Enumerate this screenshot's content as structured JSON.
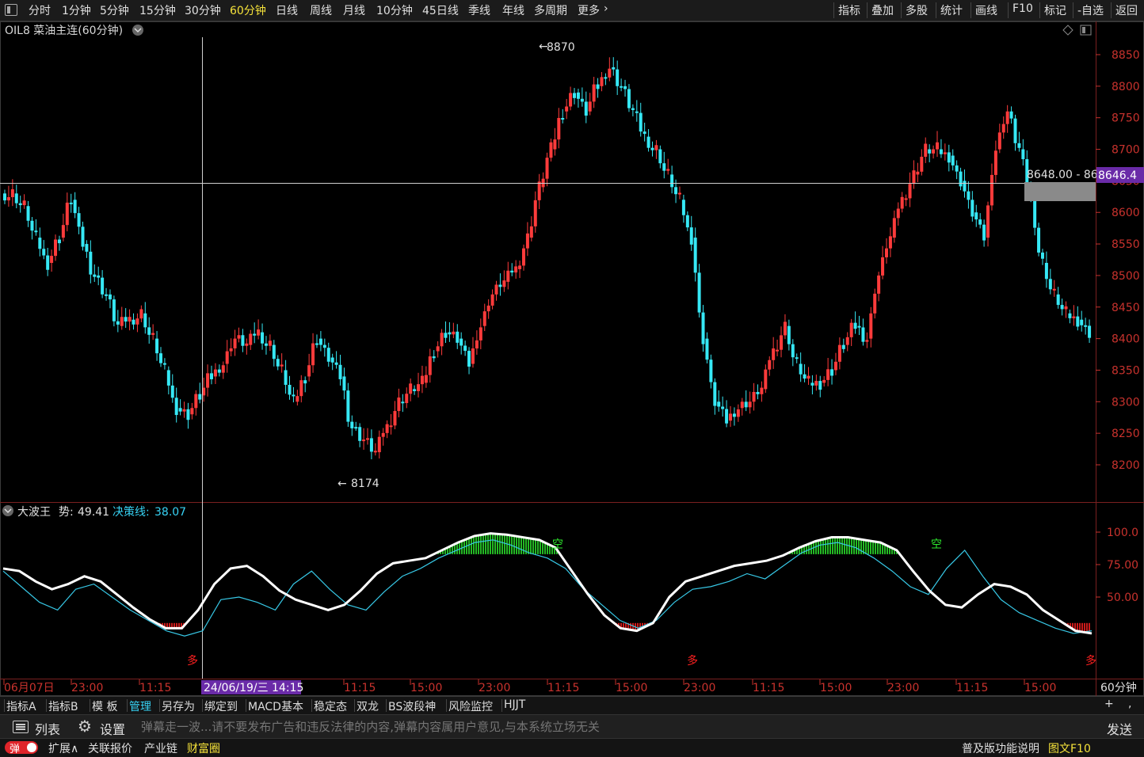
{
  "toolbar": {
    "timeframes": [
      "分时",
      "1分钟",
      "5分钟",
      "15分钟",
      "30分钟",
      "60分钟",
      "日线",
      "周线",
      "月线",
      "10分钟",
      "45日线",
      "季线",
      "年线",
      "多周期",
      "更多"
    ],
    "active_timeframe": "60分钟",
    "right_items": [
      "指标",
      "叠加",
      "多股",
      "统计",
      "画线",
      "F10",
      "标记",
      "-自选",
      "返回"
    ]
  },
  "main_chart": {
    "title": "OIL8 菜油主连(60分钟)",
    "high_label": "8870",
    "low_label": "8174",
    "crosshair_price": "8648.00 - 86",
    "current_price_tag": "8646.4",
    "price_axis": [
      "8850",
      "8800",
      "8750",
      "8700",
      "8650",
      "8600",
      "8550",
      "8500",
      "8450",
      "8400",
      "8350",
      "8300",
      "8250",
      "8200"
    ]
  },
  "indicator": {
    "name": "大波王",
    "shi_label": "势:",
    "shi_value": "49.41",
    "jueceline_label": "决策线:",
    "jueceline_value": "38.07",
    "axis": [
      "100.0",
      "75.00",
      "50.00"
    ],
    "tag_short": "空",
    "tag_long": "多"
  },
  "time_axis": {
    "labels": [
      "06月07日",
      "23:00",
      "11:15",
      "24/06/19/三 14:15",
      "11:15",
      "15:00",
      "23:00",
      "11:15",
      "15:00",
      "23:00",
      "11:15",
      "15:00",
      "23:00",
      "11:15",
      "15:00"
    ],
    "period": "60分钟"
  },
  "tabs": {
    "items": [
      "指标A",
      "指标B",
      "模 板",
      "管理",
      "另存为",
      "绑定到",
      "MACD基本",
      "稳定态",
      "双龙",
      "BS波段神",
      "风险监控",
      "HJJT"
    ],
    "active": "管理",
    "plus": "+",
    "comma": ","
  },
  "message_bar": {
    "list_label": "列表",
    "settings_label": "设置",
    "placeholder": "弹幕走一波...请不要发布广告和违反法律的内容,弹幕内容属用户意见,与本系统立场无关",
    "send_label": "发送"
  },
  "status_bar": {
    "toggle_label": "弹",
    "items": [
      "扩展∧",
      "关联报价",
      "产业链",
      "财富圈"
    ],
    "right_text": "普及版功能说明",
    "right_highlight": "图文F10"
  },
  "colors": {
    "up": "#ff3b3b",
    "down": "#36e8f5",
    "axis_red": "#c8322d",
    "active_yellow": "#f5e23a",
    "purple_tag": "#6a2ba8",
    "green_fill": "#2ee82e",
    "red_fill": "#ff2020"
  },
  "chart_data": {
    "type": "candlestick",
    "title": "OIL8 菜油主连(60分钟)",
    "ylim": [
      8160,
      8880
    ],
    "high": 8870,
    "low": 8174,
    "close_points": [
      8630,
      8610,
      8560,
      8520,
      8560,
      8620,
      8550,
      8500,
      8470,
      8420,
      8430,
      8440,
      8400,
      8350,
      8290,
      8280,
      8310,
      8340,
      8360,
      8400,
      8390,
      8410,
      8390,
      8350,
      8300,
      8340,
      8400,
      8370,
      8340,
      8260,
      8240,
      8220,
      8260,
      8300,
      8320,
      8330,
      8380,
      8410,
      8400,
      8360,
      8420,
      8470,
      8490,
      8510,
      8560,
      8640,
      8700,
      8760,
      8790,
      8760,
      8800,
      8830,
      8800,
      8760,
      8720,
      8700,
      8660,
      8620,
      8560,
      8400,
      8300,
      8270,
      8290,
      8300,
      8320,
      8380,
      8420,
      8360,
      8330,
      8330,
      8350,
      8390,
      8420,
      8400,
      8500,
      8560,
      8620,
      8660,
      8700,
      8700,
      8690,
      8650,
      8600,
      8560,
      8700,
      8760,
      8700,
      8620,
      8520,
      8470,
      8440,
      8430,
      8410
    ],
    "indicator": {
      "name": "大波王",
      "shi": [
        72,
        70,
        62,
        56,
        60,
        66,
        62,
        52,
        42,
        33,
        26,
        26,
        40,
        60,
        72,
        74,
        66,
        55,
        48,
        44,
        40,
        44,
        55,
        68,
        76,
        78,
        80,
        86,
        92,
        97,
        99,
        98,
        96,
        94,
        88,
        70,
        52,
        36,
        26,
        24,
        30,
        50,
        62,
        66,
        70,
        74,
        76,
        78,
        82,
        88,
        93,
        96,
        96,
        94,
        92,
        86,
        70,
        55,
        44,
        42,
        52,
        60,
        58,
        52,
        40,
        32,
        24,
        22
      ],
      "juece": [
        70,
        58,
        46,
        40,
        56,
        60,
        50,
        40,
        32,
        24,
        20,
        24,
        48,
        50,
        46,
        40,
        60,
        70,
        56,
        44,
        40,
        54,
        66,
        72,
        80,
        86,
        92,
        94,
        90,
        84,
        80,
        72,
        56,
        44,
        32,
        26,
        32,
        46,
        56,
        58,
        62,
        68,
        64,
        74,
        84,
        90,
        92,
        88,
        80,
        70,
        58,
        52,
        72,
        86,
        66,
        48,
        38,
        32,
        26,
        22,
        24
      ]
    }
  }
}
